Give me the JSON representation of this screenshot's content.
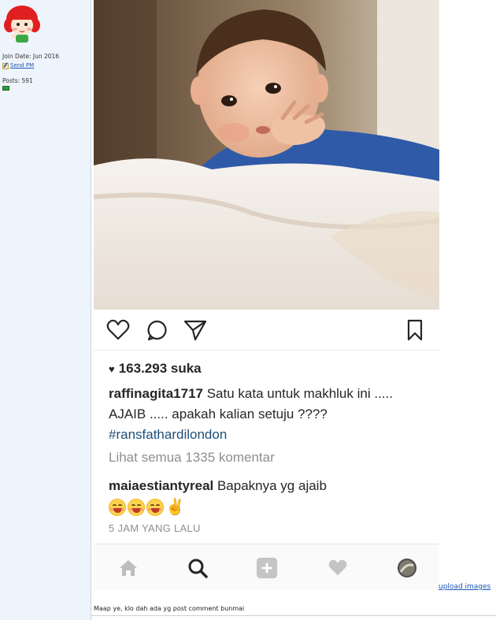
{
  "forum_user": {
    "join_date": "Join Date: Jun 2016",
    "send_pm": "Send PM",
    "posts": "Posts: 591"
  },
  "instagram_post": {
    "photo_description_icon": "baby-photo",
    "likes": "163.293 suka",
    "caption_user": "raffinagita1717",
    "caption_text": " Satu kata untuk makhluk ini ..... AJAIB ..... apakah kalian setuju ????",
    "hashtag": "#ransfathardilondon",
    "view_all_comments": "Lihat semua 1335 komentar",
    "comment_user": "maiaestiantyreal",
    "comment_text": " Bapaknya yg ajaib",
    "time_ago": "5 JAM YANG LALU",
    "nav_icons": [
      "home-icon",
      "search-icon",
      "add-post-icon",
      "activity-heart-icon",
      "profile-avatar-icon"
    ]
  },
  "upload_link": "upload images",
  "post_text": "Maap ye, klo dah ada yg post comment bunmai",
  "colors": {
    "forum_panel": "#eef4fb",
    "hashtag": "#1d4f7a",
    "link": "#1a56b8",
    "muted": "#8e8e8e"
  }
}
